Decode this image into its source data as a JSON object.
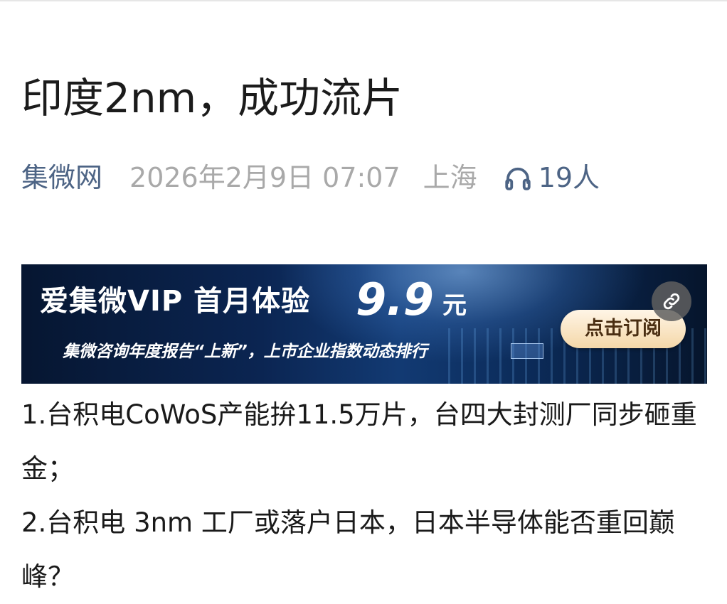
{
  "article": {
    "title": "印度2nm，成功流片",
    "source": "集微网",
    "datetime": "2026年2月9日 07:07",
    "location": "上海",
    "listeners": "19人",
    "listen_icon": "headphones-icon"
  },
  "banner": {
    "headline": "爱集微VIP 首月体验",
    "price": "9.9",
    "price_unit": "元",
    "subtitle": "集微咨询年度报告“上新”，上市企业指数动态排行",
    "cta": "点击订阅",
    "link_icon": "link-icon"
  },
  "body": {
    "paragraph_1": "1.台积电CoWoS产能拚11.5万片，台四大封测厂同步砸重金；",
    "paragraph_2": "2.台积电 3nm 工厂或落户日本，日本半导体能否重回巅峰？"
  },
  "colors": {
    "meta_accent": "#4d6485",
    "meta_muted": "#a9a9a9",
    "title_text": "#1b1b1b"
  }
}
